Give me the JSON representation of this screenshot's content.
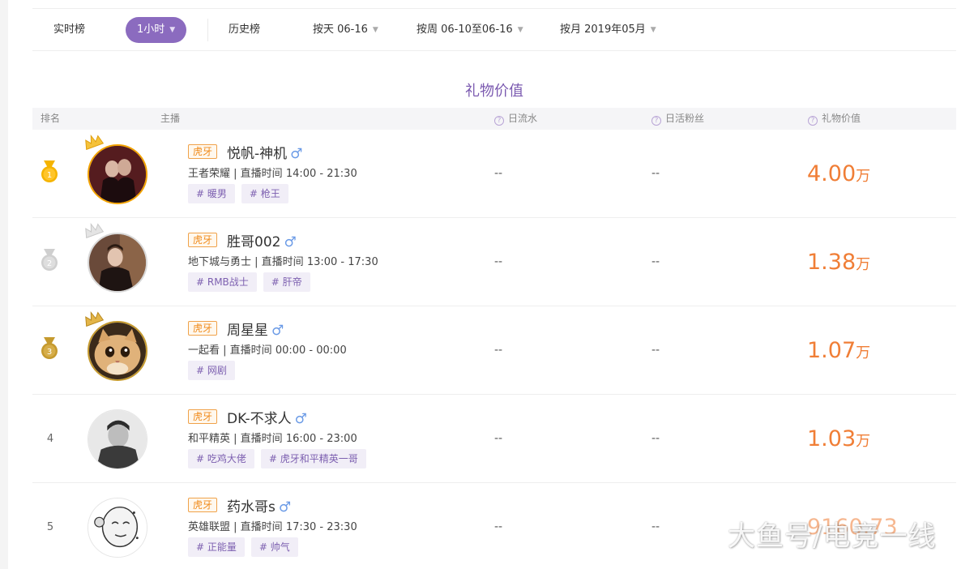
{
  "tabs": [
    {
      "label": "实时榜",
      "has_arrow": false
    },
    {
      "label": "1小时",
      "has_arrow": true,
      "active": true
    },
    {
      "label": "历史榜",
      "has_arrow": false
    },
    {
      "label": "按天 06-16",
      "has_arrow": true
    },
    {
      "label": "按周 06-10至06-16",
      "has_arrow": true
    },
    {
      "label": "按月 2019年05月",
      "has_arrow": true
    }
  ],
  "section_title": "礼物价值",
  "table_headers": {
    "rank": "排名",
    "anchor": "主播",
    "daily_flow": "日流水",
    "daily_active_fans": "日活粉丝",
    "gift_value": "礼物价值"
  },
  "rows": [
    {
      "rank": "1",
      "platform": "虎牙",
      "name": "悦帆-神机",
      "game": "王者荣耀",
      "time_label": "直播时间",
      "time": "14:00 - 21:30",
      "tags": [
        "# 暖男",
        "# 枪王"
      ],
      "daily_flow": "--",
      "daily_active_fans": "--",
      "value": "4.00",
      "unit": "万"
    },
    {
      "rank": "2",
      "platform": "虎牙",
      "name": "胜哥002",
      "game": "地下城与勇士",
      "time_label": "直播时间",
      "time": "13:00 - 17:30",
      "tags": [
        "# RMB战士",
        "# 肝帝"
      ],
      "daily_flow": "--",
      "daily_active_fans": "--",
      "value": "1.38",
      "unit": "万"
    },
    {
      "rank": "3",
      "platform": "虎牙",
      "name": "周星星",
      "game": "一起看",
      "time_label": "直播时间",
      "time": "00:00 - 00:00",
      "tags": [
        "# 网剧"
      ],
      "daily_flow": "--",
      "daily_active_fans": "--",
      "value": "1.07",
      "unit": "万"
    },
    {
      "rank": "4",
      "platform": "虎牙",
      "name": "DK-不求人",
      "game": "和平精英",
      "time_label": "直播时间",
      "time": "16:00 - 23:00",
      "tags": [
        "# 吃鸡大佬",
        "# 虎牙和平精英一哥"
      ],
      "daily_flow": "--",
      "daily_active_fans": "--",
      "value": "1.03",
      "unit": "万"
    },
    {
      "rank": "5",
      "platform": "虎牙",
      "name": "药水哥s",
      "game": "英雄联盟",
      "time_label": "直播时间",
      "time": "17:30 - 23:30",
      "tags": [
        "# 正能量",
        "# 帅气"
      ],
      "daily_flow": "--",
      "daily_active_fans": "--",
      "value": "9160.73",
      "unit": ""
    }
  ],
  "watermark": "大鱼号/电竞一线",
  "colors": {
    "accent_purple": "#8b6bbf",
    "value_orange": "#f07e36",
    "platform_orange": "#f08a1a",
    "gold": "#f2a200",
    "silver": "#cfcfcf",
    "bronze": "#c59a2e"
  },
  "icons": {
    "male": "♂",
    "question": "?",
    "arrow": "▼"
  }
}
